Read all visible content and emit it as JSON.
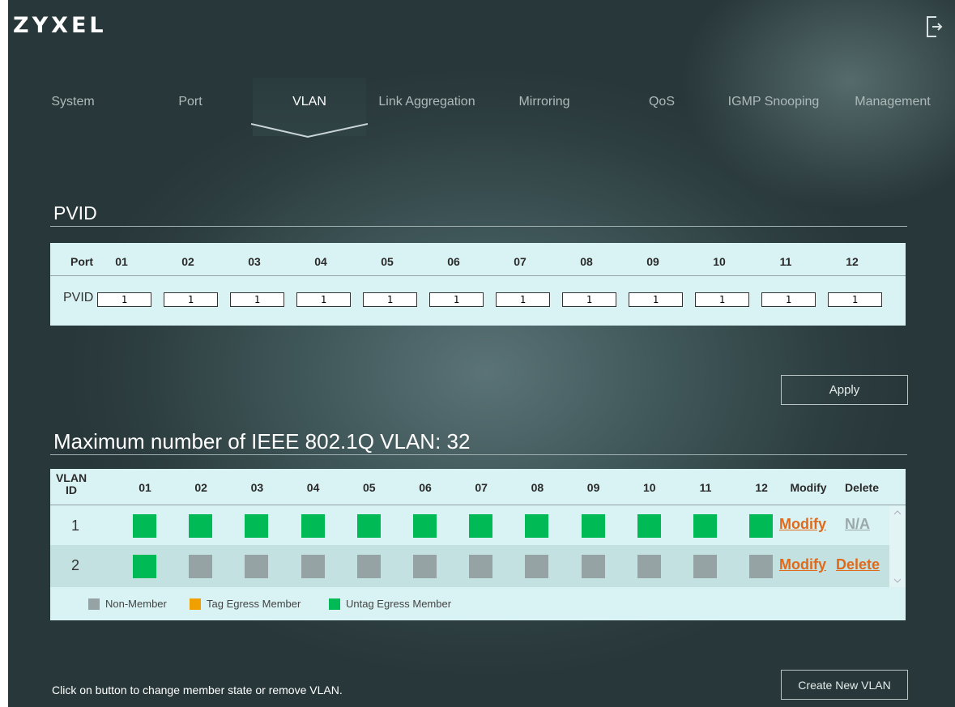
{
  "brand": {
    "name": "ZYXEL"
  },
  "nav": {
    "items": [
      {
        "label": "System"
      },
      {
        "label": "Port"
      },
      {
        "label": "VLAN"
      },
      {
        "label": "Link Aggregation"
      },
      {
        "label": "Mirroring"
      },
      {
        "label": "QoS"
      },
      {
        "label": "IGMP Snooping"
      },
      {
        "label": "Management"
      }
    ],
    "active": "VLAN"
  },
  "pvid": {
    "title": "PVID",
    "row_header_port": "Port",
    "row_header_pvid": "PVID",
    "ports": [
      "01",
      "02",
      "03",
      "04",
      "05",
      "06",
      "07",
      "08",
      "09",
      "10",
      "11",
      "12"
    ],
    "values": [
      "1",
      "1",
      "1",
      "1",
      "1",
      "1",
      "1",
      "1",
      "1",
      "1",
      "1",
      "1"
    ],
    "apply_label": "Apply"
  },
  "vlan": {
    "title": "Maximum number of IEEE 802.1Q VLAN: 32",
    "header_id": "VLAN ID",
    "header_modify": "Modify",
    "header_delete": "Delete",
    "ports": [
      "01",
      "02",
      "03",
      "04",
      "05",
      "06",
      "07",
      "08",
      "09",
      "10",
      "11",
      "12"
    ],
    "rows": [
      {
        "id": "1",
        "members": [
          "untag",
          "untag",
          "untag",
          "untag",
          "untag",
          "untag",
          "untag",
          "untag",
          "untag",
          "untag",
          "untag",
          "untag"
        ],
        "modify": "Modify",
        "delete": "N/A"
      },
      {
        "id": "2",
        "members": [
          "untag",
          "non",
          "non",
          "non",
          "non",
          "non",
          "non",
          "non",
          "non",
          "non",
          "non",
          "non"
        ],
        "modify": "Modify",
        "delete": "Delete"
      }
    ],
    "legend": {
      "non_member": "Non-Member",
      "tag_egress": "Tag Egress Member",
      "untag_egress": "Untag Egress Member"
    },
    "colors": {
      "untag": "#00bb55",
      "non": "#95a3a5",
      "tag": "#f0a000",
      "link": "#e06a1a",
      "na": "#9aa8aa"
    }
  },
  "footer": {
    "hint": "Click on button to change member state or remove VLAN.",
    "create_label": "Create New VLAN"
  }
}
